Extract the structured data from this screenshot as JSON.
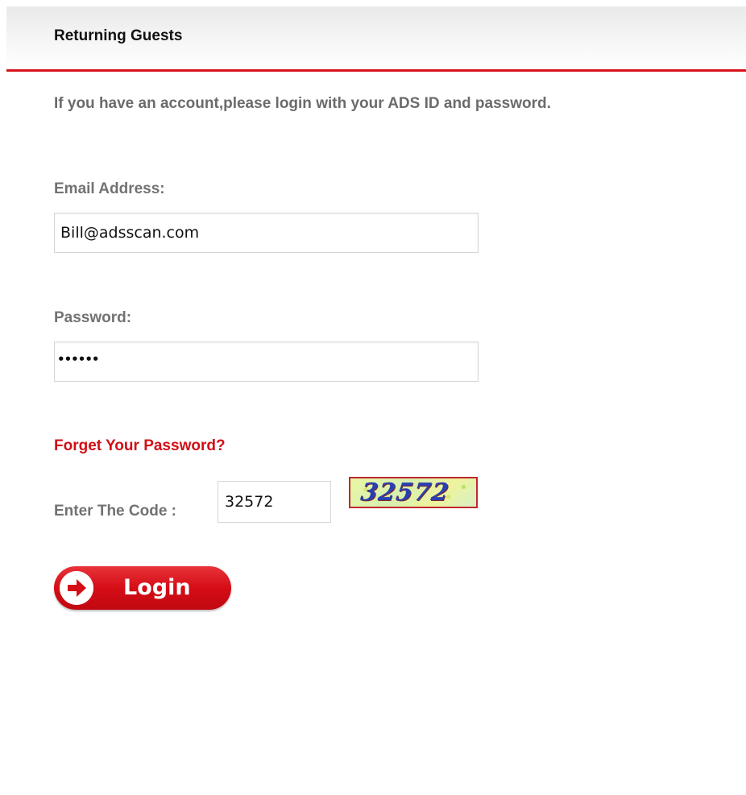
{
  "header": {
    "title": "Returning Guests"
  },
  "intro": {
    "text": "If you have an account,please login with your ADS ID and password."
  },
  "form": {
    "email_label": "Email Address:",
    "email_value": "Bill@adsscan.com",
    "password_label": "Password:",
    "password_masked": "••••••",
    "forgot_link": "Forget Your Password?",
    "code_label": "Enter The Code :",
    "code_value": "32572",
    "captcha_text": "32572",
    "login_label": "Login"
  },
  "colors": {
    "accent_red": "#d8121b",
    "label_gray": "#727272",
    "captcha_blue": "#2a3fb0"
  },
  "icons": {
    "login": "arrow-right-circle-icon"
  }
}
